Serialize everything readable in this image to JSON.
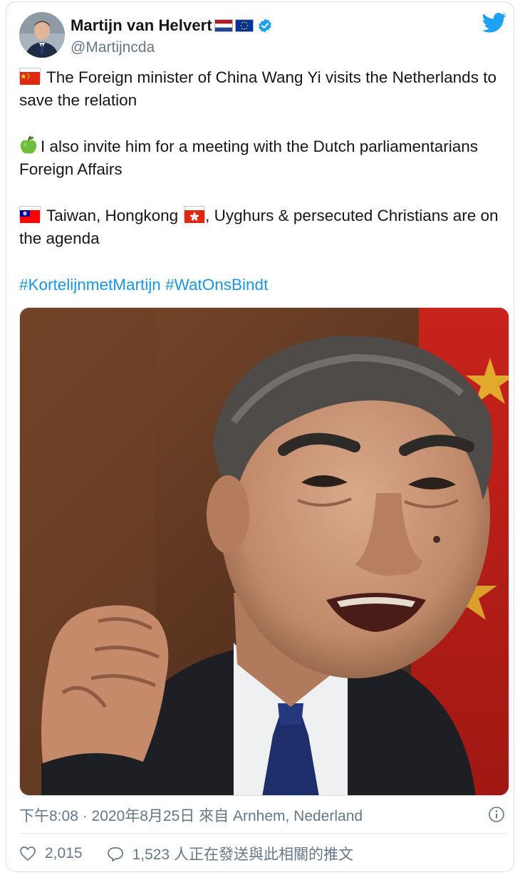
{
  "author": {
    "name": "Martijn van Helvert",
    "handle": "@Martijncda"
  },
  "tweet": {
    "line1": "The Foreign minister of China Wang Yi visits the Netherlands to save the relation",
    "line2": "I also invite him for a meeting with the Dutch parliamentarians Foreign Affairs",
    "line3_a": "Taiwan, Hongkong",
    "line3_b": ", Uyghurs  & persecuted Christians are on the agenda",
    "hashtags": [
      "#KortelijnmetMartijn",
      "#WatOnsBindt"
    ]
  },
  "meta": {
    "timestamp": "下午8:08 · 2020年8月25日 來自 Arnhem, Nederland"
  },
  "actions": {
    "likes": "2,015",
    "replies": "1,523 人正在發送與此相關的推文"
  },
  "colors": {
    "link": "#1b95e0",
    "secondary": "#657786",
    "twitter_blue": "#1da1f2"
  },
  "icons": [
    "netherlands-flag-icon",
    "eu-flag-icon",
    "verified-badge-icon",
    "twitter-bird-icon",
    "china-flag-icon",
    "green-apple-icon",
    "taiwan-flag-icon",
    "hongkong-flag-icon",
    "info-icon",
    "heart-icon",
    "reply-icon"
  ]
}
